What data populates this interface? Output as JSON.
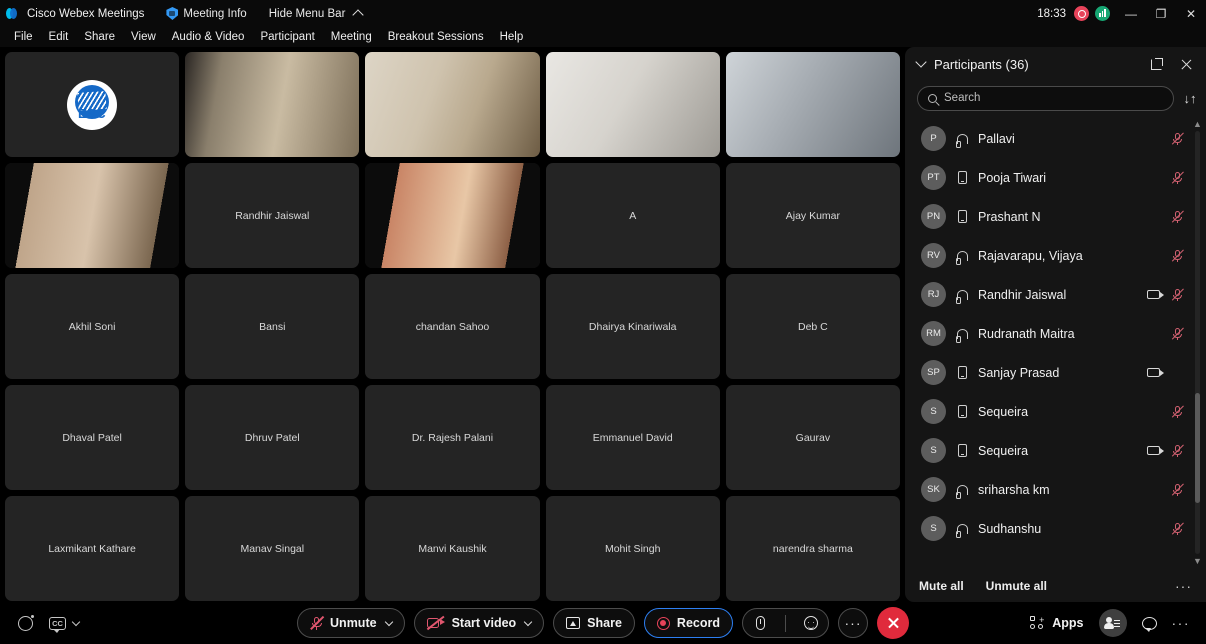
{
  "titlebar": {
    "app_name": "Cisco Webex Meetings",
    "meeting_info": "Meeting Info",
    "hide_menu_bar": "Hide Menu Bar",
    "clock": "18:33",
    "minimize": "—",
    "maximize": "❐",
    "close": "✕"
  },
  "menubar": {
    "items": [
      {
        "label": "File"
      },
      {
        "label": "Edit"
      },
      {
        "label": "Share"
      },
      {
        "label": "View"
      },
      {
        "label": "Audio & Video"
      },
      {
        "label": "Participant"
      },
      {
        "label": "Meeting"
      },
      {
        "label": "Breakout Sessions"
      },
      {
        "label": "Help"
      }
    ]
  },
  "stage": {
    "tiles": [
      {
        "name": "",
        "kind": "logo",
        "logo_text": "ESC"
      },
      {
        "name": "",
        "kind": "video",
        "bg": "vb-b"
      },
      {
        "name": "",
        "kind": "video",
        "bg": "vb-a"
      },
      {
        "name": "",
        "kind": "video",
        "bg": "vb-c"
      },
      {
        "name": "",
        "kind": "video",
        "bg": "vb-d"
      },
      {
        "name": "",
        "kind": "video",
        "bg": "vb-e"
      },
      {
        "name": "Randhir Jaiswal",
        "kind": "placeholder"
      },
      {
        "name": "",
        "kind": "video",
        "bg": "vb-f"
      },
      {
        "name": "A",
        "kind": "placeholder"
      },
      {
        "name": "Ajay Kumar",
        "kind": "placeholder"
      },
      {
        "name": "Akhil Soni",
        "kind": "placeholder"
      },
      {
        "name": "Bansi",
        "kind": "placeholder"
      },
      {
        "name": "chandan Sahoo",
        "kind": "placeholder"
      },
      {
        "name": "Dhairya Kinariwala",
        "kind": "placeholder"
      },
      {
        "name": "Deb C",
        "kind": "placeholder"
      },
      {
        "name": "Dhaval Patel",
        "kind": "placeholder"
      },
      {
        "name": "Dhruv Patel",
        "kind": "placeholder"
      },
      {
        "name": "Dr. Rajesh Palani",
        "kind": "placeholder"
      },
      {
        "name": "Emmanuel David",
        "kind": "placeholder"
      },
      {
        "name": "Gaurav",
        "kind": "placeholder"
      },
      {
        "name": "Laxmikant Kathare",
        "kind": "placeholder"
      },
      {
        "name": "Manav Singal",
        "kind": "placeholder"
      },
      {
        "name": "Manvi Kaushik",
        "kind": "placeholder"
      },
      {
        "name": "Mohit Singh",
        "kind": "placeholder"
      },
      {
        "name": "narendra sharma",
        "kind": "placeholder"
      }
    ]
  },
  "panel": {
    "title": "Participants (36)",
    "search_placeholder": "Search",
    "search_value": "",
    "sort_icon": "↓↑",
    "popout_icon": "popout-icon",
    "close_icon": "close-icon",
    "participants": [
      {
        "initials": "P",
        "name": "Pallavi",
        "device": "headset",
        "video": false,
        "muted": true
      },
      {
        "initials": "PT",
        "name": "Pooja Tiwari",
        "device": "phone",
        "video": false,
        "muted": true
      },
      {
        "initials": "PN",
        "name": "Prashant N",
        "device": "phone",
        "video": false,
        "muted": true
      },
      {
        "initials": "RV",
        "name": "Rajavarapu, Vijaya",
        "device": "headset",
        "video": false,
        "muted": true
      },
      {
        "initials": "RJ",
        "name": "Randhir Jaiswal",
        "device": "headset",
        "video": true,
        "muted": true
      },
      {
        "initials": "RM",
        "name": "Rudranath Maitra",
        "device": "headset",
        "video": false,
        "muted": true
      },
      {
        "initials": "SP",
        "name": "Sanjay Prasad",
        "device": "phone",
        "video": true,
        "muted": false
      },
      {
        "initials": "S",
        "name": "Sequeira",
        "device": "phone",
        "video": false,
        "muted": true
      },
      {
        "initials": "S",
        "name": "Sequeira",
        "device": "phone",
        "video": true,
        "muted": true
      },
      {
        "initials": "SK",
        "name": "sriharsha km",
        "device": "headset",
        "video": false,
        "muted": true
      },
      {
        "initials": "S",
        "name": "Sudhanshu",
        "device": "headset",
        "video": false,
        "muted": true
      }
    ],
    "footer": {
      "mute_all": "Mute all",
      "unmute_all": "Unmute all",
      "more": "···"
    }
  },
  "toolbar": {
    "assistant_icon": "webex-assistant-icon",
    "cc_label": "CC",
    "unmute": "Unmute",
    "start_video": "Start video",
    "share": "Share",
    "record": "Record",
    "more": "···",
    "apps": "Apps",
    "leave_icon": "close-icon"
  },
  "colors": {
    "accent_blue": "#2d7ff2",
    "mute_red": "#e0566e",
    "leave_red": "#e02a3c",
    "record_red": "#e8435a",
    "panel_bg": "#151515",
    "tile_bg": "#242424"
  }
}
